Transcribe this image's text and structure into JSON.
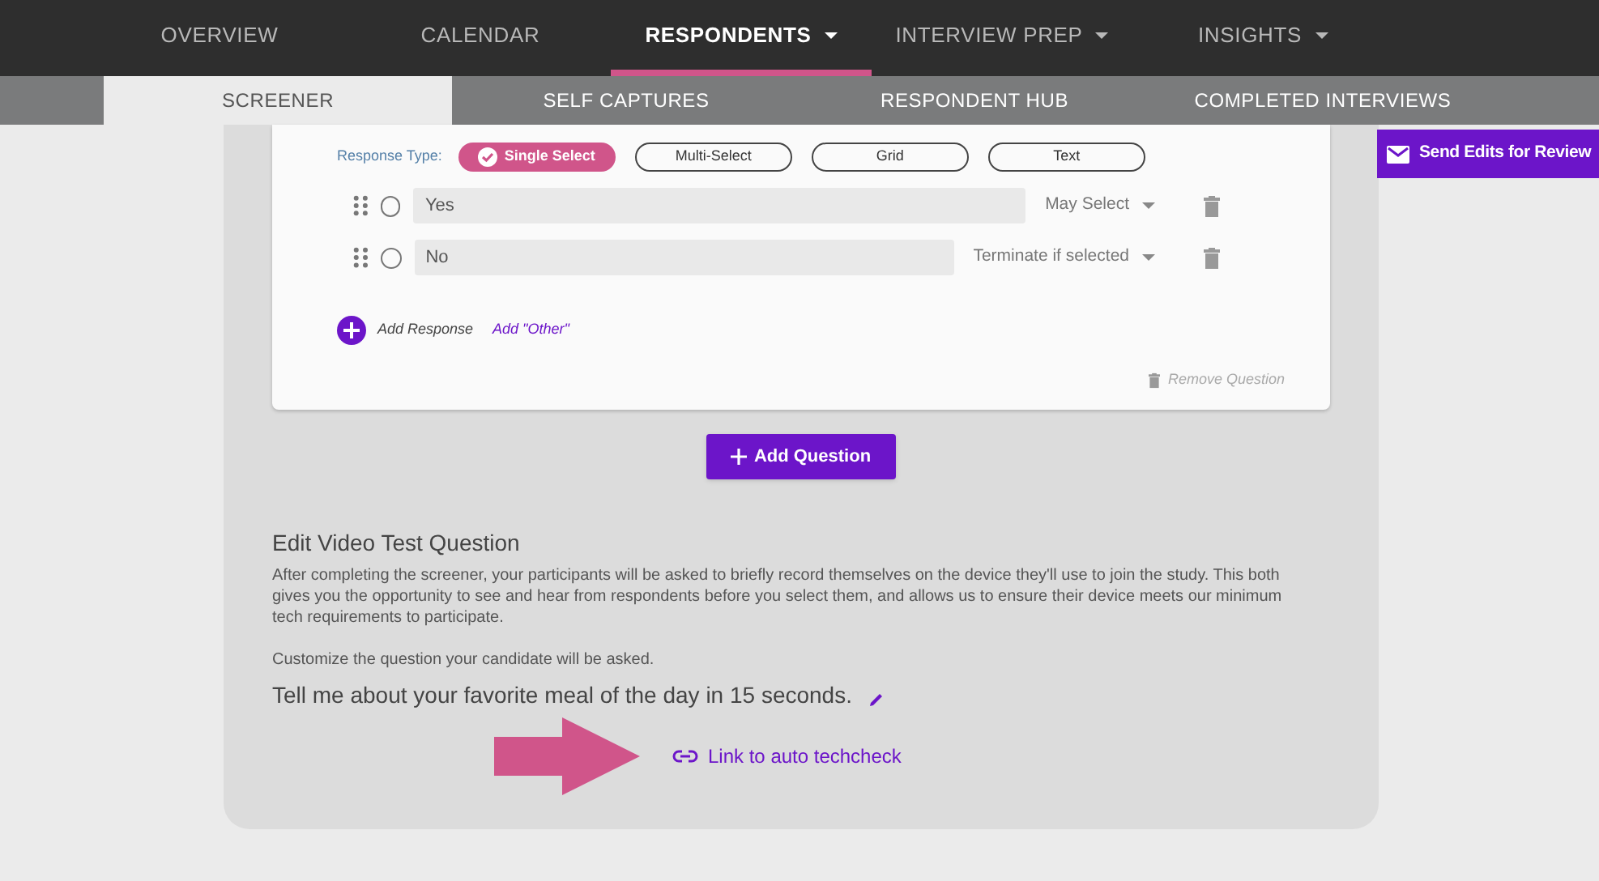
{
  "nav": {
    "tabs": [
      {
        "label": "OVERVIEW",
        "selected": false,
        "dropdown": false
      },
      {
        "label": "CALENDAR",
        "selected": false,
        "dropdown": false
      },
      {
        "label": "RESPONDENTS",
        "selected": true,
        "dropdown": true
      },
      {
        "label": "INTERVIEW PREP",
        "selected": false,
        "dropdown": true
      },
      {
        "label": "INSIGHTS",
        "selected": false,
        "dropdown": true
      }
    ]
  },
  "subnav": {
    "tabs": [
      {
        "label": "SCREENER",
        "selected": true
      },
      {
        "label": "SELF CAPTURES",
        "selected": false
      },
      {
        "label": "RESPONDENT HUB",
        "selected": false
      },
      {
        "label": "COMPLETED INTERVIEWS",
        "selected": false
      }
    ]
  },
  "send_button": "Send Edits for Review",
  "question": {
    "response_type_label": "Response Type:",
    "response_types": [
      {
        "label": "Single Select",
        "selected": true
      },
      {
        "label": "Multi-Select",
        "selected": false
      },
      {
        "label": "Grid",
        "selected": false
      },
      {
        "label": "Text",
        "selected": false
      }
    ],
    "responses": [
      {
        "value": "Yes",
        "rule": "May Select",
        "checked": false
      },
      {
        "value": "No",
        "rule": "Terminate if selected",
        "checked": false
      }
    ],
    "add_response": "Add Response",
    "add_other": "Add \"Other\"",
    "remove": "Remove Question"
  },
  "add_question": "Add Question",
  "video_test": {
    "title": "Edit Video Test Question",
    "description": "After completing the screener, your participants will be asked to briefly record themselves on the device they'll use to join the study. This both gives you the opportunity to see and hear from respondents before you select them, and allows us to ensure their device meets our minimum tech requirements to participate.",
    "instruction": "Customize the question your candidate will be asked.",
    "prompt": "Tell me about your favorite meal of the day in 15 seconds.",
    "link": "Link to auto techcheck"
  }
}
